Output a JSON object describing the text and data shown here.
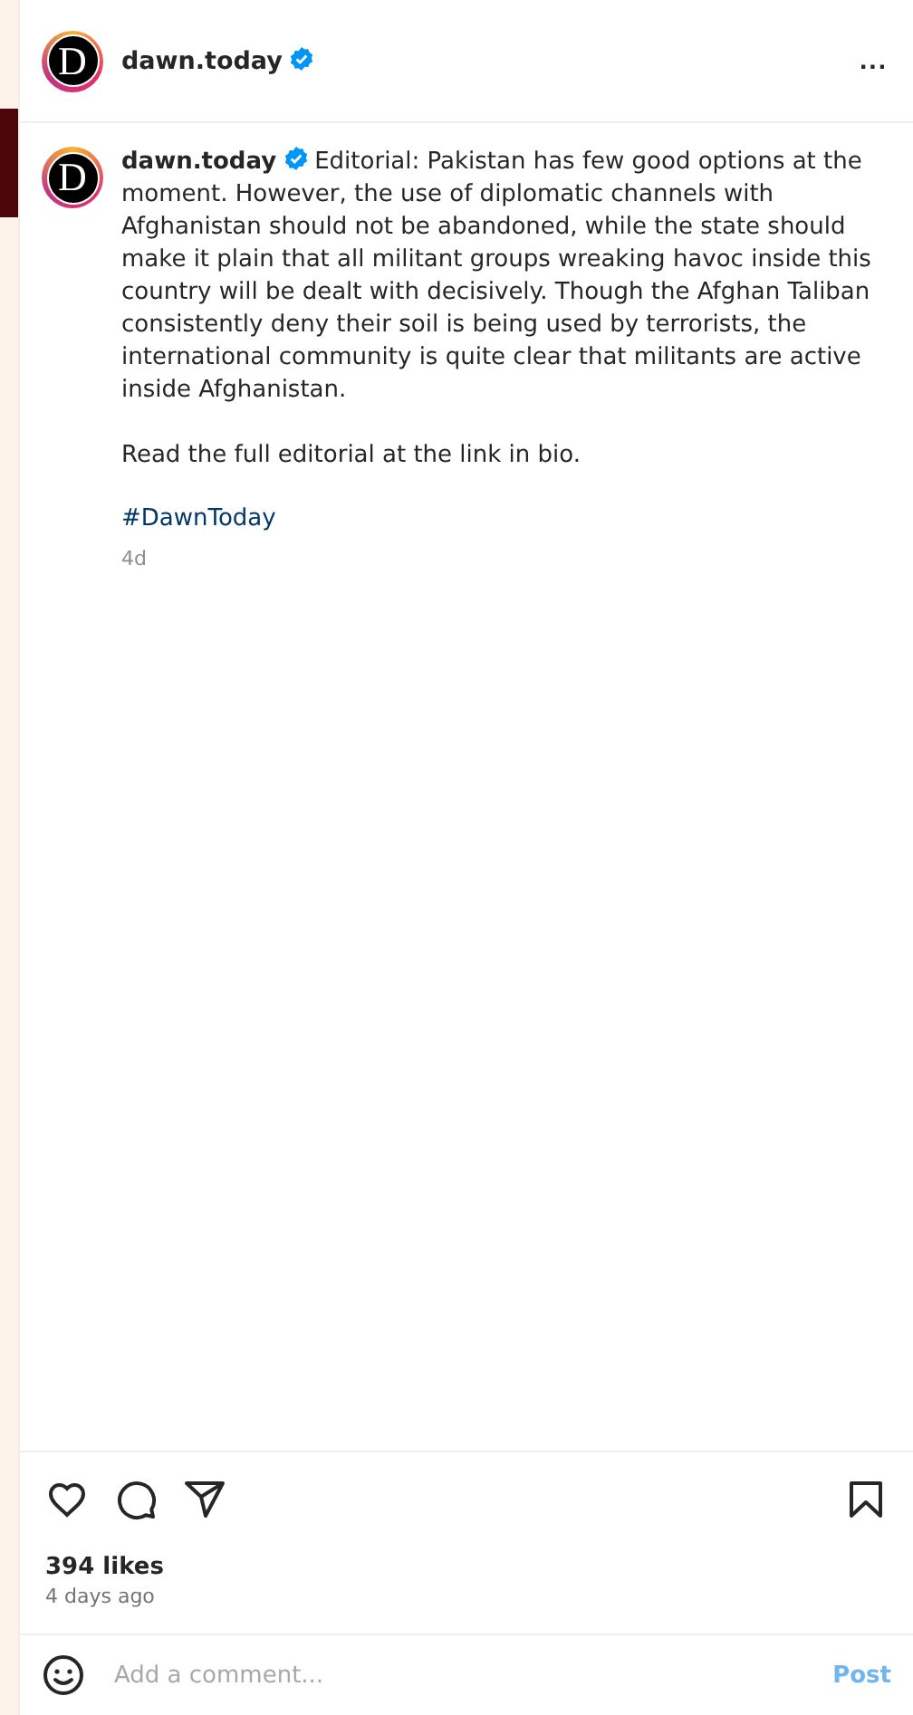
{
  "header": {
    "avatar_letter": "D",
    "username": "dawn.today",
    "verified": true,
    "more": "..."
  },
  "caption": {
    "avatar_letter": "D",
    "username": "dawn.today",
    "verified": true,
    "paragraphs": [
      "Editorial: Pakistan has few good options at the moment. However, the use of diplomatic channels with Afghanistan should not be abandoned, while the state should make it plain that all militant groups wreaking havoc inside this country will be dealt with decisively. Though the Afghan Taliban consistently deny their soil is being used by terrorists, the international community is quite clear that militants are active inside Afghanistan.",
      "Read the full editorial at the link in bio."
    ],
    "hashtag": "#DawnToday",
    "age": "4d"
  },
  "actions": {
    "liked": false,
    "saved": false
  },
  "likes": "394 likes",
  "time": "4 days ago",
  "comment": {
    "placeholder": "Add a comment...",
    "post_label": "Post",
    "post_disabled": true
  }
}
